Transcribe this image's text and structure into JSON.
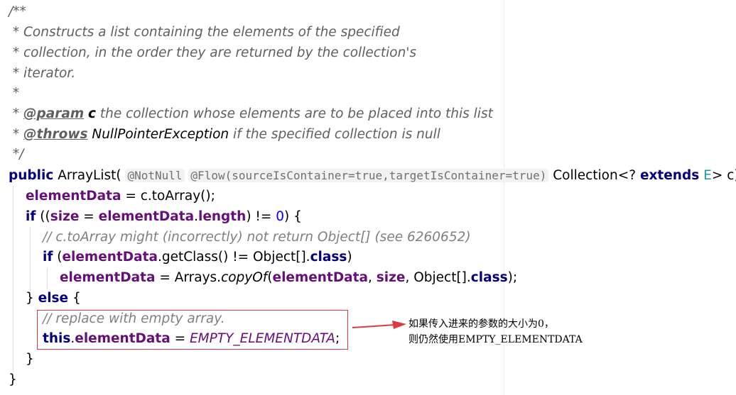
{
  "doc": {
    "open": "/**",
    "l1": " * Constructs a list containing the elements of the specified",
    "l2": " * collection, in the order they are returned by the collection's",
    "l3": " * iterator.",
    "l4": " *",
    "star": " * ",
    "param_tag": "@param",
    "param_name": "c",
    "param_desc": " the collection whose elements are to be placed into this list",
    "throws_tag": "@throws",
    "throws_exc": "NullPointerException",
    "throws_desc": " if the specified collection is null",
    "close": " */"
  },
  "sig": {
    "public": "public",
    "name": " ArrayList(",
    "ann1": "@NotNull",
    "ann2": "@Flow(sourceIsContainer=true,targetIsContainer=true)",
    "type": "Collection<?",
    "extends": "extends",
    "tparam": "E",
    "rest": "> c) {"
  },
  "code": {
    "l1_field": "elementData",
    "l1_rest": " = c.toArray();",
    "l2_if": "if",
    "l2_a": " ((",
    "l2_size": "size",
    "l2_b": " = ",
    "l2_field": "elementData",
    "l2_dot": ".",
    "l2_length": "length",
    "l2_c": ") != ",
    "l2_zero": "0",
    "l2_d": ") {",
    "l3_comment": "// c.toArray might (incorrectly) not return Object[] (see 6260652)",
    "l4_if": "if",
    "l4_a": " (",
    "l4_field": "elementData",
    "l4_b": ".getClass() != Object[].",
    "l4_class": "class",
    "l4_c": ")",
    "l5_field": "elementData",
    "l5_a": " = Arrays.",
    "l5_method": "copyOf",
    "l5_b": "(",
    "l5_field2": "elementData",
    "l5_c": ", ",
    "l5_size": "size",
    "l5_d": ", Object[].",
    "l5_class": "class",
    "l5_e": ");",
    "l6_a": "} ",
    "l6_else": "else",
    "l6_b": " {",
    "l7_comment": "// replace with empty array.",
    "l8_this": "this",
    "l8_dot": ".",
    "l8_field": "elementData",
    "l8_a": " = ",
    "l8_const": "EMPTY_ELEMENTDATA",
    "l8_b": ";",
    "l9": "}",
    "l10": "}"
  },
  "annotation": {
    "line1": "如果传入进来的参数的大小为0，",
    "line2": "则仍然使用EMPTY_ELEMENTDATA",
    "box_color": "#e0393f",
    "arrow_color": "#e0393f"
  }
}
